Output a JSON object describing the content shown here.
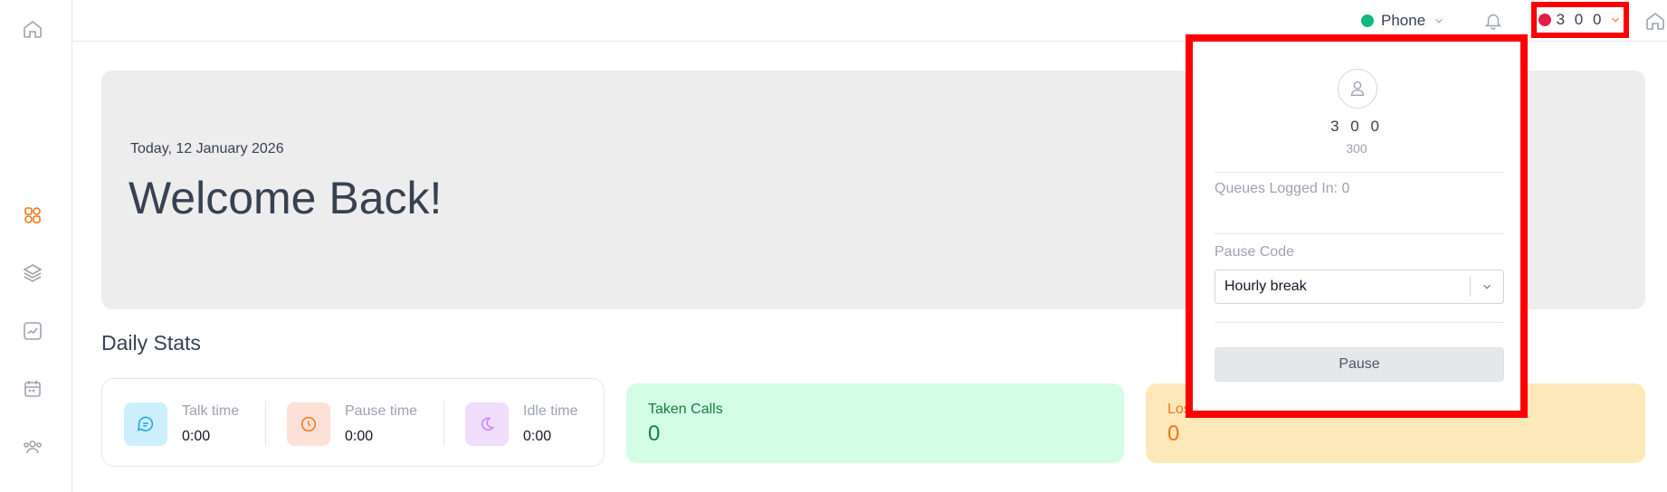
{
  "topbar": {
    "phone_label": "Phone",
    "phone_status_color": "#10b981",
    "user_label": "3 0 0",
    "user_status_color": "#e11d48"
  },
  "hero": {
    "date": "Today, 12 January 2026",
    "title": "Welcome Back!"
  },
  "daily": {
    "title": "Daily Stats",
    "stats": [
      {
        "label": "Talk time",
        "value": "0:00",
        "icon": "chat-icon",
        "bg": "#cdeefd",
        "color": "#0ea5e9"
      },
      {
        "label": "Pause time",
        "value": "0:00",
        "icon": "clock-icon",
        "bg": "#fde0d7",
        "color": "#f97316"
      },
      {
        "label": "Idle time",
        "value": "0:00",
        "icon": "moon-icon",
        "bg": "#f0dcfb",
        "color": "#c084fc"
      }
    ],
    "kpis": [
      {
        "label": "Taken Calls",
        "value": "0",
        "bg": "#d4fde6",
        "color": "#15803d"
      },
      {
        "label": "Lost Attempts",
        "value": "0",
        "bg": "#fde8b9",
        "color": "#f97316"
      }
    ]
  },
  "panel": {
    "name": "3 0 0",
    "extension": "300",
    "queues": "Queues Logged In: 0",
    "pause_code_label": "Pause Code",
    "pause_code_value": "Hourly break",
    "pause_button": "Pause"
  },
  "icons": {
    "sidebar": [
      "home-icon",
      "dashboard-icon",
      "layers-icon",
      "chart-icon",
      "calendar-icon",
      "users-icon"
    ],
    "accent": "#f97316"
  }
}
